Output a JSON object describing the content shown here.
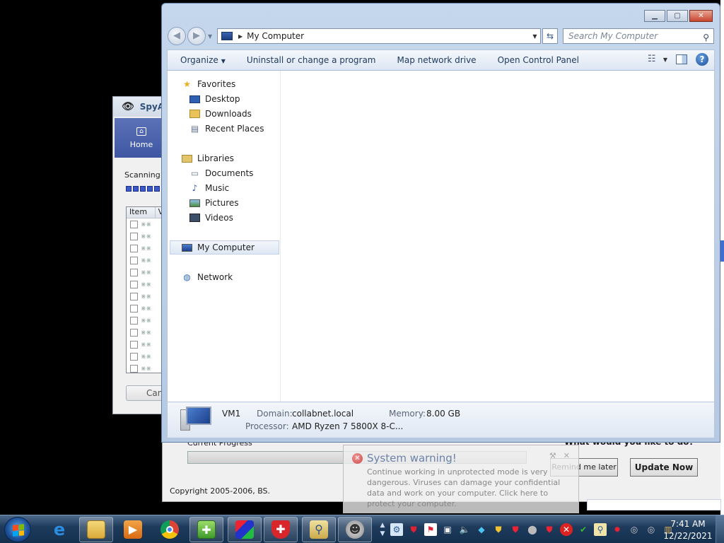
{
  "spyware_window": {
    "title": "SpyA",
    "home_label": "Home",
    "scanning_text": "Scanning c",
    "list_headers": [
      "Item",
      "V"
    ],
    "row_count": 13,
    "cancel_label": "Can"
  },
  "update_dialog": {
    "progress_label": "Current Progress",
    "question": "What would you like to do?",
    "remind_label": "Remind me later",
    "update_label": "Update Now",
    "copyright": "Copyright 2005-2006, BS."
  },
  "explorer": {
    "caption_buttons": {
      "minimize": "▁",
      "maximize": "▢",
      "close": "✕"
    },
    "address": {
      "location": "My Computer"
    },
    "search": {
      "placeholder": "Search My Computer"
    },
    "toolbar": {
      "organize": "Organize",
      "uninstall": "Uninstall or change a program",
      "map_drive": "Map network drive",
      "control_panel": "Open Control Panel"
    },
    "nav": {
      "favorites": "Favorites",
      "desktop": "Desktop",
      "downloads": "Downloads",
      "recent": "Recent Places",
      "libraries": "Libraries",
      "documents": "Documents",
      "music": "Music",
      "pictures": "Pictures",
      "videos": "Videos",
      "my_computer": "My Computer",
      "network": "Network"
    },
    "details": {
      "name": "VM1",
      "domain_label": "Domain:",
      "domain_value": "collabnet.local",
      "memory_label": "Memory:",
      "memory_value": "8.00 GB",
      "processor_label": "Processor:",
      "processor_value": "AMD Ryzen 7 5800X 8-C..."
    }
  },
  "warning": {
    "title": "System warning!",
    "body": "Continue working in unprotected mode is very dangerous. Viruses can damage your confidential data and work on your computer. Click here to protect your computer."
  },
  "taskbar": {
    "apps": [
      {
        "name": "internet-explorer",
        "active": false
      },
      {
        "name": "windows-explorer",
        "active": true
      },
      {
        "name": "media-player",
        "active": false
      },
      {
        "name": "chrome",
        "active": false
      },
      {
        "name": "green-box-app",
        "active": true
      },
      {
        "name": "colored-blocks-app",
        "active": true
      },
      {
        "name": "red-shield-app",
        "active": true
      },
      {
        "name": "magnifier-app",
        "active": true
      },
      {
        "name": "robot-app",
        "active": true
      }
    ],
    "clock": {
      "time": "7:41 AM",
      "date": "12/22/2021"
    }
  },
  "colors": {
    "accent": "#3c59c8",
    "warning_title": "#6c83a8",
    "taskbar": "#1f3b5c"
  }
}
